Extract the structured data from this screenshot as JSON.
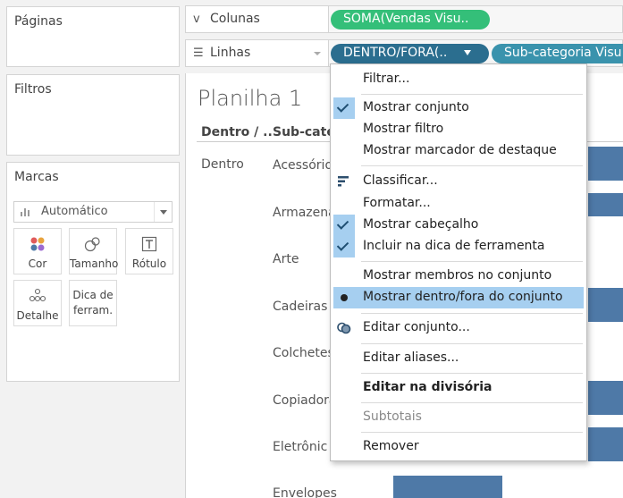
{
  "left_panel": {
    "pages": {
      "title": "Páginas"
    },
    "filters": {
      "title": "Filtros"
    },
    "marks": {
      "title": "Marcas",
      "type_select": {
        "value": "Automático",
        "icon": "bar-chart-icon"
      },
      "buttons": [
        {
          "label": "Cor",
          "icon": "color-dots-icon"
        },
        {
          "label": "Tamanho",
          "icon": "size-icon"
        },
        {
          "label": "Rótulo",
          "icon": "text-label-icon"
        },
        {
          "label": "Detalhe",
          "icon": "detail-dots-icon"
        },
        {
          "label": "Dica de ferram.",
          "label_line1": "Dica de",
          "label_line2": "ferram.",
          "icon": "none"
        }
      ]
    }
  },
  "shelves": {
    "columns": {
      "label": "Colunas",
      "icon": "columns-icon",
      "pills": [
        {
          "text": "SOMA(Vendas Visu..",
          "color": "#34bf79"
        }
      ]
    },
    "rows": {
      "label": "Linhas",
      "icon": "rows-icon",
      "pills": [
        {
          "text": "DENTRO/FORA(..",
          "color": "#2b6e8f"
        },
        {
          "text": "Sub-categoria Visu",
          "color": "#3a93ad"
        }
      ]
    }
  },
  "view": {
    "sheet_title": "Planilha 1",
    "headers": [
      "Dentro / ..",
      "Sub-categ"
    ],
    "in_out_value": "Dentro",
    "subcategories": [
      "Acessório",
      "Armazena",
      "Arte",
      "Cadeiras",
      "Colchetes",
      "Copiadora",
      "Eletrônic",
      "Envelopes"
    ],
    "bar_color": "#4e79a7"
  },
  "context_menu": {
    "items": [
      {
        "label": "Filtrar...",
        "state": "none"
      },
      {
        "label": "Mostrar conjunto",
        "state": "checked"
      },
      {
        "label": "Mostrar filtro",
        "state": "none"
      },
      {
        "label": "Mostrar marcador de destaque",
        "state": "none"
      },
      {
        "label": "Classificar...",
        "state": "sort-icon"
      },
      {
        "label": "Formatar...",
        "state": "none"
      },
      {
        "label": "Mostrar cabeçalho",
        "state": "checked"
      },
      {
        "label": "Incluir na dica de ferramenta",
        "state": "checked"
      },
      {
        "label": "Mostrar membros no conjunto",
        "state": "none"
      },
      {
        "label": "Mostrar dentro/fora do conjunto",
        "state": "selected-radio"
      },
      {
        "label": "Editar conjunto...",
        "state": "set-icon"
      },
      {
        "label": "Editar aliases...",
        "state": "none"
      },
      {
        "label": "Editar na divisória",
        "state": "bold"
      },
      {
        "label": "Subtotais",
        "state": "disabled"
      },
      {
        "label": "Remover",
        "state": "none"
      }
    ],
    "highlight_color": "#a6cff0"
  }
}
